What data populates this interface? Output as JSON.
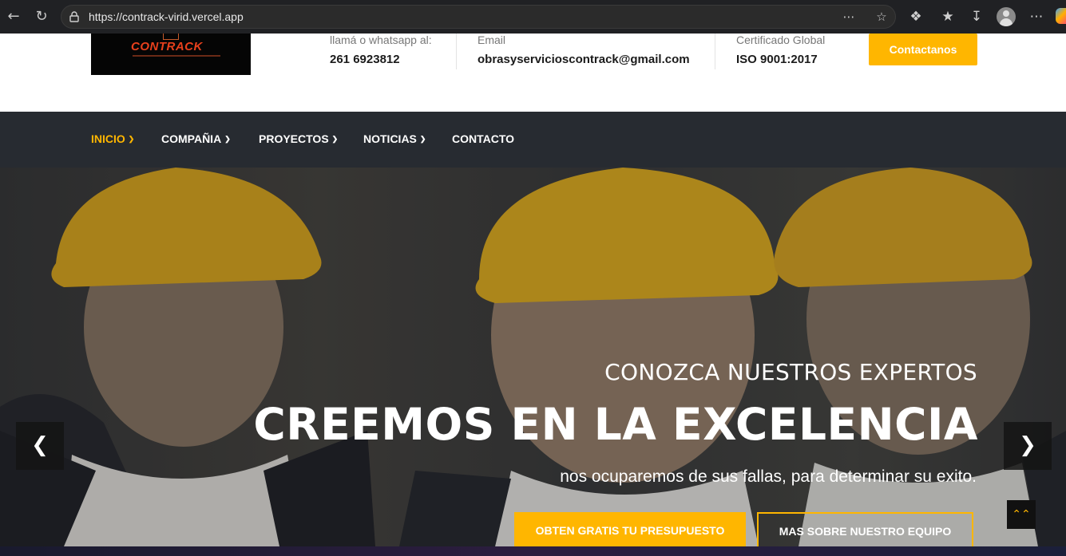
{
  "browser": {
    "url": "https://contrack-virid.vercel.app",
    "icons": {
      "back": "back-arrow-icon",
      "refresh": "refresh-icon",
      "lock": "lock-icon",
      "reader": "reader-mode-icon",
      "favorite": "star-icon",
      "extensions": "extensions-icon",
      "favorites": "favorites-icon",
      "downloads": "download-icon",
      "profile": "avatar-icon",
      "more": "more-icon"
    }
  },
  "header": {
    "phone_label": "llamá o whatsapp al:",
    "phone_value": "261 6923812",
    "email_label": "Email",
    "email_value": "obrasyservicioscontrack@gmail.com",
    "cert_label": "Certificado Global",
    "cert_value": "ISO 9001:2017",
    "contact_button": "Contactanos",
    "logo_text": "CONTRACK"
  },
  "nav": {
    "items": [
      {
        "label": "INICIO",
        "active": true,
        "dropdown": true
      },
      {
        "label": "COMPAÑIA",
        "active": false,
        "dropdown": true
      },
      {
        "label": "PROYECTOS",
        "active": false,
        "dropdown": true
      },
      {
        "label": "NOTICIAS",
        "active": false,
        "dropdown": true
      },
      {
        "label": "CONTACTO",
        "active": false,
        "dropdown": false
      }
    ]
  },
  "hero": {
    "subtitle": "CONOZCA NUESTROS EXPERTOS",
    "title": "CREEMOS EN LA EXCELENCIA",
    "text": "nos ocuparemos de sus fallas, para determinar su exito.",
    "primary_button": "OBTEN GRATIS TU PRESUPUESTO",
    "secondary_button": "MAS SOBRE NUESTRO EQUIPO",
    "prev_icon": "chevron-left-icon",
    "next_icon": "chevron-right-icon",
    "to_top_icon": "double-chevron-up-icon"
  },
  "colors": {
    "accent": "#ffb600",
    "navbar": "#272b31",
    "logo_text": "#e8401c"
  }
}
